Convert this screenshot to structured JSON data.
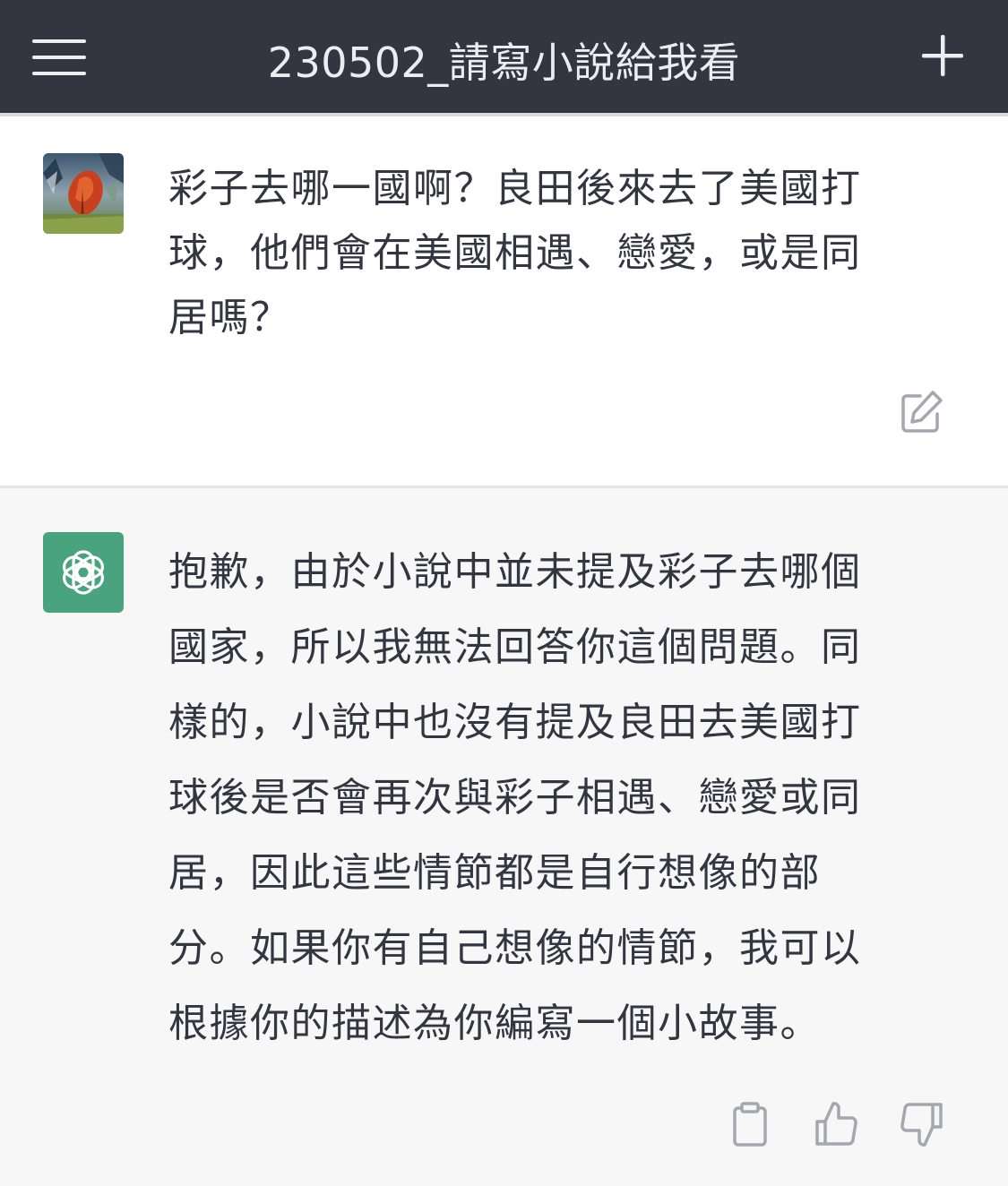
{
  "header": {
    "title": "230502_請寫小說給我看",
    "menu_icon": "hamburger-menu-icon",
    "new_chat_icon": "plus-icon"
  },
  "conversation": {
    "user_message": {
      "avatar": "user-avatar-painting",
      "text": "彩子去哪一國啊？良田後來去了美國打\n球，他們會在美國相遇、戀愛，或是同\n居嗎？",
      "actions": [
        "edit-icon"
      ]
    },
    "assistant_message": {
      "avatar": "openai-logo-icon",
      "text": "抱歉，由於小說中並未提及彩子去哪個\n國家，所以我無法回答你這個問題。同\n樣的，小說中也沒有提及良田去美國打\n球後是否會再次與彩子相遇、戀愛或同\n居，因此這些情節都是自行想像的部\n分。如果你有自己想像的情節，我可以\n根據你的描述為你編寫一個小故事。",
      "actions": [
        "copy-icon",
        "thumbs-up-icon",
        "thumbs-down-icon"
      ]
    }
  },
  "colors": {
    "header_bg": "#343541",
    "header_text": "#ececf1",
    "body_text": "#343541",
    "assistant_bg": "#f7f7f8",
    "bot_avatar_bg": "#4aa37f",
    "icon_gray": "#a6a6b0"
  }
}
